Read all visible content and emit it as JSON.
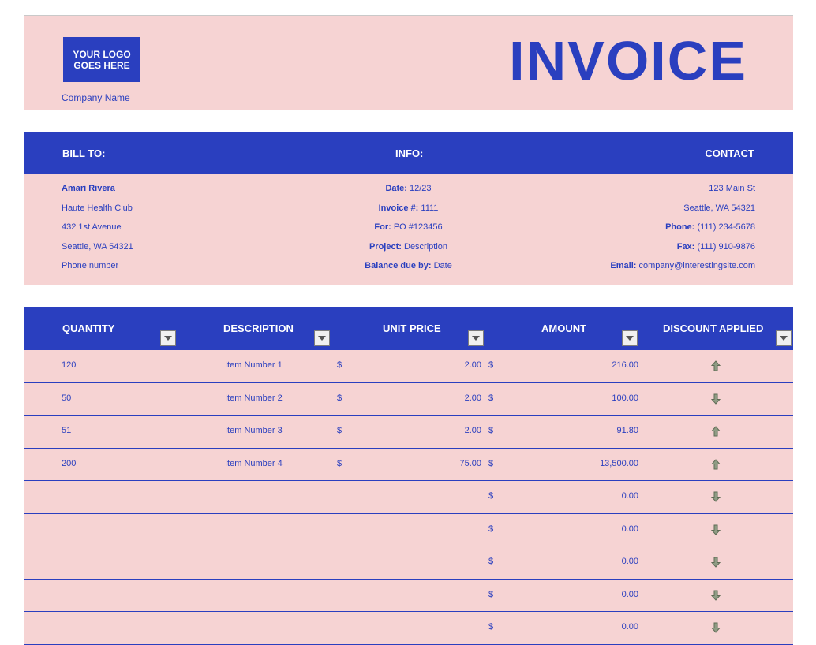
{
  "header": {
    "logo_text": "YOUR LOGO\nGOES HERE",
    "company_name": "Company Name",
    "title": "INVOICE"
  },
  "info_bar": {
    "bill_to": "BILL TO:",
    "info": "INFO:",
    "contact": "CONTACT"
  },
  "bill_to": [
    "Amari Rivera",
    "Haute Health Club",
    "432 1st Avenue",
    "Seattle, WA 54321",
    "Phone number"
  ],
  "info": [
    {
      "label": "Date:",
      "value": "12/23"
    },
    {
      "label": "Invoice #:",
      "value": "1111"
    },
    {
      "label": "For:",
      "value": "PO #123456"
    },
    {
      "label": "Project:",
      "value": "Description"
    },
    {
      "label": "Balance due by:",
      "value": "Date"
    }
  ],
  "contact": [
    {
      "label": "",
      "value": "123 Main St"
    },
    {
      "label": "",
      "value": "Seattle, WA 54321"
    },
    {
      "label": "Phone:",
      "value": "(111) 234-5678"
    },
    {
      "label": "Fax:",
      "value": "(111) 910-9876"
    },
    {
      "label": "Email:",
      "value": "company@interestingsite.com"
    }
  ],
  "table": {
    "columns": [
      "QUANTITY",
      "DESCRIPTION",
      "UNIT PRICE",
      "AMOUNT",
      "DISCOUNT APPLIED"
    ],
    "currency": "$",
    "rows": [
      {
        "quantity": "120",
        "description": "Item Number 1",
        "unit_price": "2.00",
        "amount": "216.00",
        "discount": "up"
      },
      {
        "quantity": "50",
        "description": "Item Number 2",
        "unit_price": "2.00",
        "amount": "100.00",
        "discount": "down"
      },
      {
        "quantity": "51",
        "description": "Item Number 3",
        "unit_price": "2.00",
        "amount": "91.80",
        "discount": "up"
      },
      {
        "quantity": "200",
        "description": "Item Number 4",
        "unit_price": "75.00",
        "amount": "13,500.00",
        "discount": "up"
      },
      {
        "quantity": "",
        "description": "",
        "unit_price": "",
        "amount": "0.00",
        "discount": "down"
      },
      {
        "quantity": "",
        "description": "",
        "unit_price": "",
        "amount": "0.00",
        "discount": "down"
      },
      {
        "quantity": "",
        "description": "",
        "unit_price": "",
        "amount": "0.00",
        "discount": "down"
      },
      {
        "quantity": "",
        "description": "",
        "unit_price": "",
        "amount": "0.00",
        "discount": "down"
      },
      {
        "quantity": "",
        "description": "",
        "unit_price": "",
        "amount": "0.00",
        "discount": "down"
      }
    ]
  },
  "colors": {
    "accent": "#2a3fbf",
    "band": "#f6d3d3",
    "arrow": "#7a8a6e"
  },
  "icons": {
    "discount_up": "arrow-up-icon",
    "discount_down": "arrow-down-icon",
    "filter": "dropdown-filter-icon"
  }
}
